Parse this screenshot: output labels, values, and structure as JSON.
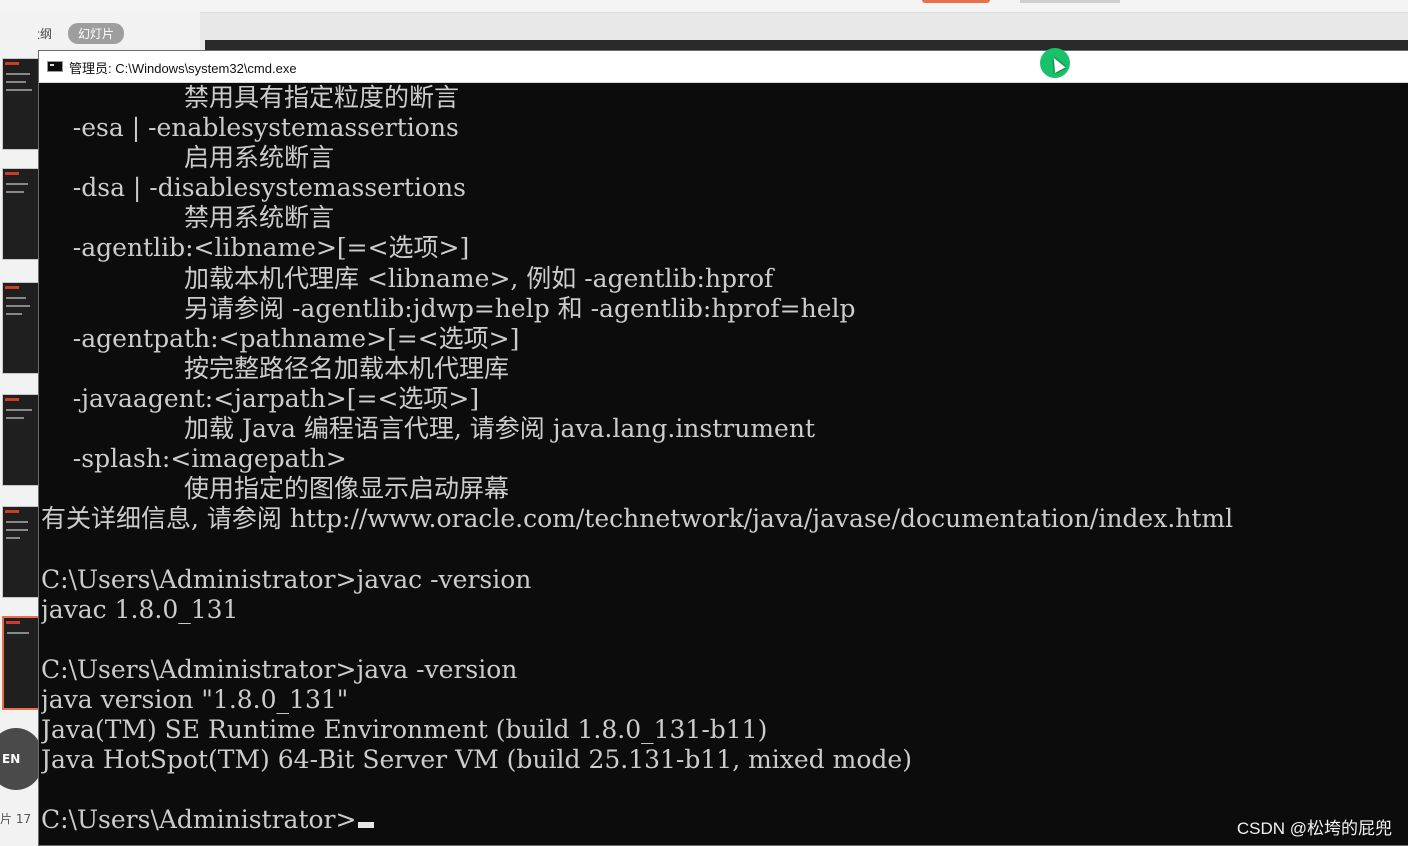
{
  "app": {
    "tab_outline": "大纲",
    "tab_slides": "幻灯片",
    "slide_number": "片 17",
    "language_badge": "EN"
  },
  "window": {
    "title": "管理员: C:\\Windows\\system32\\cmd.exe",
    "icon": "cmd-icon"
  },
  "console": {
    "lines": [
      "                  禁用具有指定粒度的断言",
      "    -esa | -enablesystemassertions",
      "                  启用系统断言",
      "    -dsa | -disablesystemassertions",
      "                  禁用系统断言",
      "    -agentlib:<libname>[=<选项>]",
      "                  加载本机代理库 <libname>, 例如 -agentlib:hprof",
      "                  另请参阅 -agentlib:jdwp=help 和 -agentlib:hprof=help",
      "    -agentpath:<pathname>[=<选项>]",
      "                  按完整路径名加载本机代理库",
      "    -javaagent:<jarpath>[=<选项>]",
      "                  加载 Java 编程语言代理, 请参阅 java.lang.instrument",
      "    -splash:<imagepath>",
      "                  使用指定的图像显示启动屏幕",
      "有关详细信息, 请参阅 http://www.oracle.com/technetwork/java/javase/documentation/index.html",
      "",
      "C:\\Users\\Administrator>javac -version",
      "javac 1.8.0_131",
      "",
      "C:\\Users\\Administrator>java -version",
      "java version \"1.8.0_131\"",
      "Java(TM) SE Runtime Environment (build 1.8.0_131-b11)",
      "Java HotSpot(TM) 64-Bit Server VM (build 25.131-b11, mixed mode)",
      "",
      "C:\\Users\\Administrator>"
    ]
  },
  "watermark": "CSDN @松垮的屁兜",
  "colors": {
    "console_bg": "#0c0c0c",
    "console_fg": "#cccccc",
    "cursor_highlight": "#17c26a",
    "accent": "#e8704a"
  }
}
